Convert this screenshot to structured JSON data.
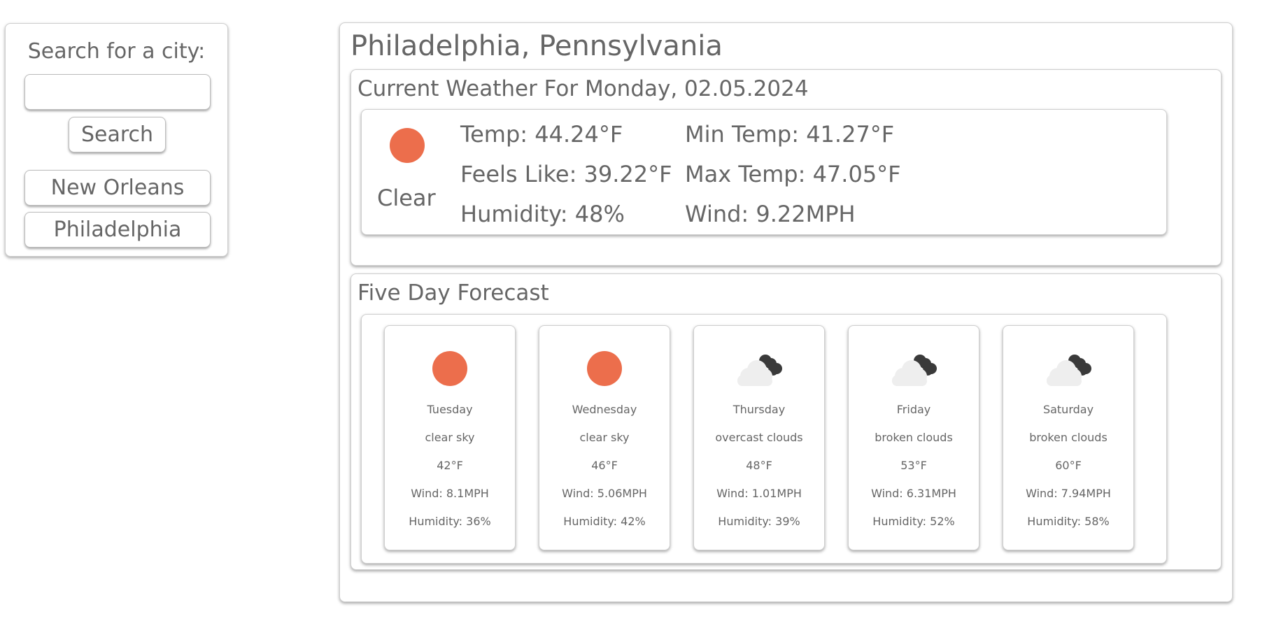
{
  "sidebar": {
    "search_label": "Search for a city:",
    "search_value": "",
    "search_button_label": "Search",
    "history": [
      "New Orleans",
      "Philadelphia"
    ]
  },
  "main": {
    "city_title": "Philadelphia, Pennsylvania",
    "current": {
      "heading": "Current Weather For Monday, 02.05.2024",
      "icon": "sun-icon",
      "description": "Clear",
      "temp": "Temp: 44.24°F",
      "feels_like": "Feels Like: 39.22°F",
      "humidity": "Humidity: 48%",
      "min_temp": "Min Temp: 41.27°F",
      "max_temp": "Max Temp: 47.05°F",
      "wind": "Wind: 9.22MPH"
    },
    "forecast": {
      "heading": "Five Day Forecast",
      "days": [
        {
          "day": "Tuesday",
          "desc": "clear sky",
          "temp": "42°F",
          "wind": "Wind: 8.1MPH",
          "humidity": "Humidity: 36%",
          "icon": "sun-icon"
        },
        {
          "day": "Wednesday",
          "desc": "clear sky",
          "temp": "46°F",
          "wind": "Wind: 5.06MPH",
          "humidity": "Humidity: 42%",
          "icon": "sun-icon"
        },
        {
          "day": "Thursday",
          "desc": "overcast clouds",
          "temp": "48°F",
          "wind": "Wind: 1.01MPH",
          "humidity": "Humidity: 39%",
          "icon": "clouds-icon"
        },
        {
          "day": "Friday",
          "desc": "broken clouds",
          "temp": "53°F",
          "wind": "Wind: 6.31MPH",
          "humidity": "Humidity: 52%",
          "icon": "clouds-icon"
        },
        {
          "day": "Saturday",
          "desc": "broken clouds",
          "temp": "60°F",
          "wind": "Wind: 7.94MPH",
          "humidity": "Humidity: 58%",
          "icon": "clouds-icon"
        }
      ]
    }
  },
  "colors": {
    "sun": "#ec6e4c",
    "cloud_light": "#eeeeee",
    "cloud_dark": "#3a3a3a",
    "text": "#666666"
  }
}
